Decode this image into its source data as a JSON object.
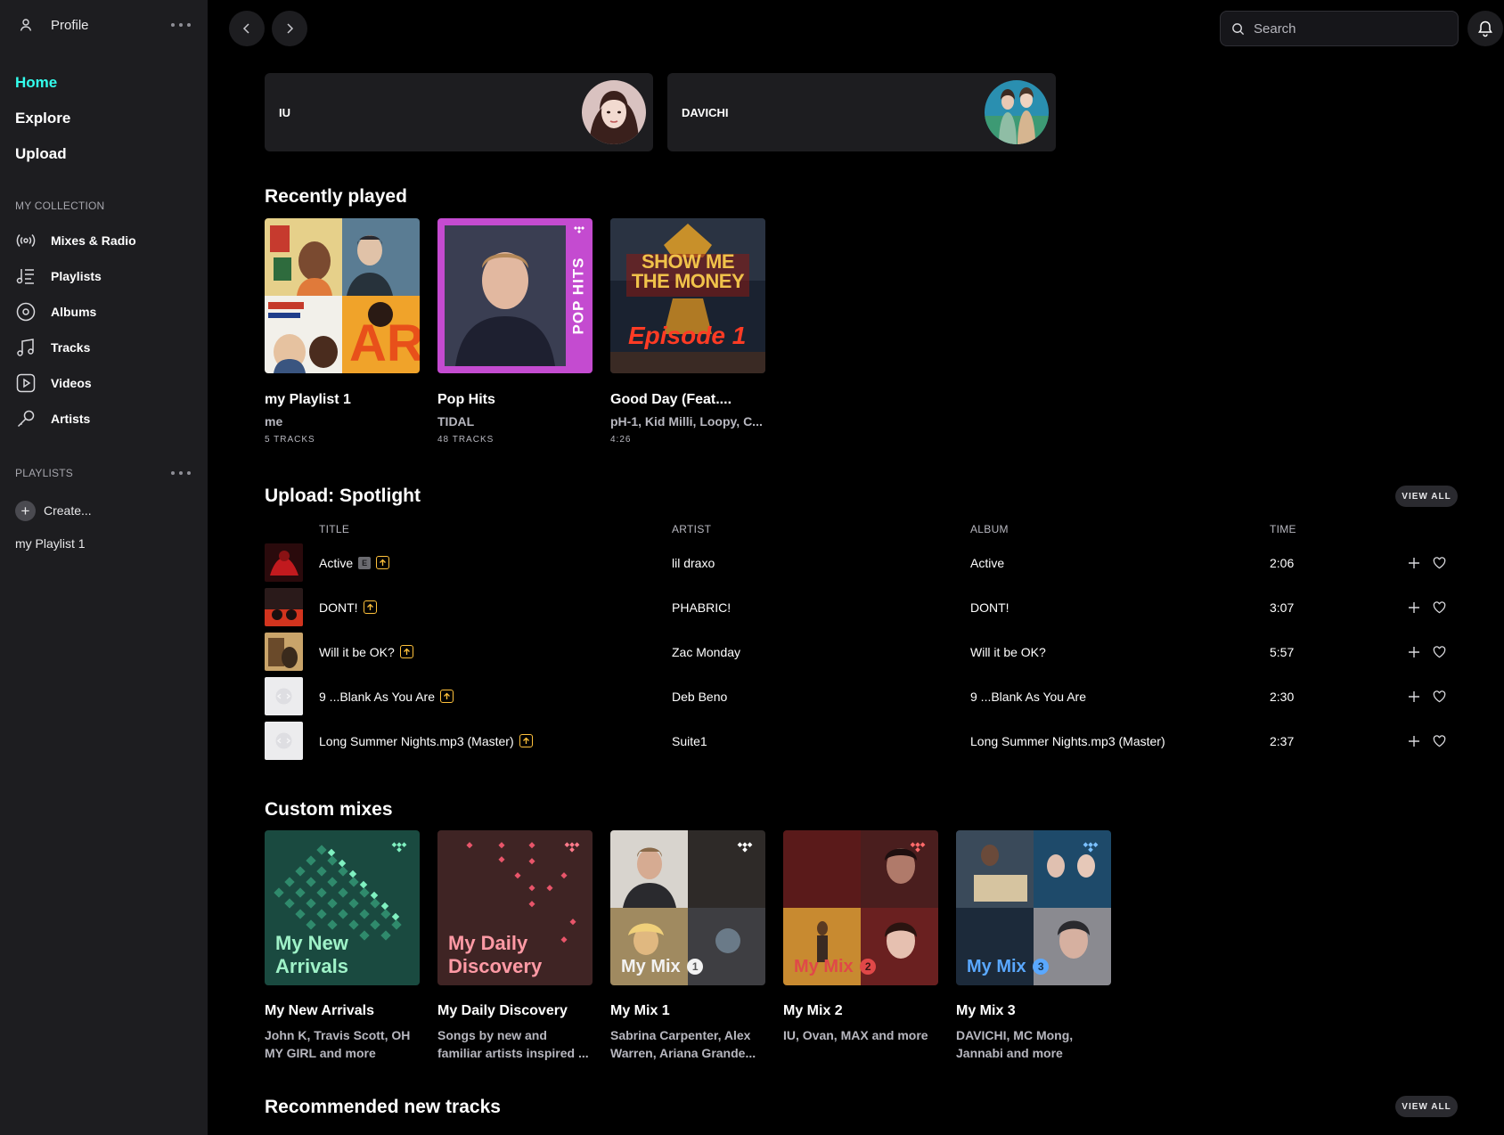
{
  "sidebar": {
    "profile_label": "Profile",
    "nav": [
      {
        "label": "Home",
        "active": true
      },
      {
        "label": "Explore",
        "active": false
      },
      {
        "label": "Upload",
        "active": false
      }
    ],
    "collection_heading": "MY COLLECTION",
    "collection": [
      {
        "label": "Mixes & Radio",
        "icon": "radio-icon"
      },
      {
        "label": "Playlists",
        "icon": "playlist-icon"
      },
      {
        "label": "Albums",
        "icon": "album-icon"
      },
      {
        "label": "Tracks",
        "icon": "music-note-icon"
      },
      {
        "label": "Videos",
        "icon": "video-icon"
      },
      {
        "label": "Artists",
        "icon": "microphone-icon"
      }
    ],
    "playlists_heading": "PLAYLISTS",
    "create_label": "Create...",
    "playlists": [
      "my Playlist 1"
    ]
  },
  "topbar": {
    "search_placeholder": "Search"
  },
  "artists": [
    {
      "name": "IU"
    },
    {
      "name": "DAVICHI"
    }
  ],
  "recently_played": {
    "heading": "Recently played",
    "items": [
      {
        "title": "my Playlist 1",
        "subtitle": "me",
        "meta": "5 TRACKS"
      },
      {
        "title": "Pop Hits",
        "subtitle": "TIDAL",
        "meta": "48 TRACKS",
        "cover_text": "POP HITS"
      },
      {
        "title": "Good Day (Feat....",
        "subtitle": "pH-1, Kid Milli, Loopy, C...",
        "meta": "4:26",
        "cover_text_top": "SHOW ME THE MONEY",
        "cover_text": "Episode 1"
      }
    ]
  },
  "spotlight": {
    "heading": "Upload: Spotlight",
    "view_all": "VIEW ALL",
    "columns": {
      "title": "TITLE",
      "artist": "ARTIST",
      "album": "ALBUM",
      "time": "TIME"
    },
    "explicit_badge": "E",
    "tracks": [
      {
        "title": "Active",
        "explicit": true,
        "artist": "lil draxo",
        "album": "Active",
        "time": "2:06"
      },
      {
        "title": "DONT!",
        "explicit": false,
        "artist": "PHABRIC!",
        "album": "DONT!",
        "time": "3:07"
      },
      {
        "title": "Will it be OK?",
        "explicit": false,
        "artist": "Zac Monday",
        "album": "Will it be OK?",
        "time": "5:57"
      },
      {
        "title": "9 ...Blank As You Are",
        "explicit": false,
        "artist": "Deb Beno",
        "album": "9 ...Blank As You Are",
        "time": "2:30"
      },
      {
        "title": "Long Summer Nights.mp3 (Master)",
        "explicit": false,
        "artist": "Suite1",
        "album": "Long Summer Nights.mp3 (Master)",
        "time": "2:37"
      }
    ]
  },
  "custom_mixes": {
    "heading": "Custom mixes",
    "items": [
      {
        "cover_line1": "My New",
        "cover_line2": "Arrivals",
        "title": "My New Arrivals",
        "subtitle": "John K, Travis Scott, OH MY GIRL and more"
      },
      {
        "cover_line1": "My Daily",
        "cover_line2": "Discovery",
        "title": "My Daily Discovery",
        "subtitle": "Songs by new and familiar artists inspired ..."
      },
      {
        "cover_label": "My Mix",
        "cover_num": "1",
        "title": "My Mix 1",
        "subtitle": "Sabrina Carpenter, Alex Warren, Ariana Grande..."
      },
      {
        "cover_label": "My Mix",
        "cover_num": "2",
        "title": "My Mix 2",
        "subtitle": "IU, Ovan, MAX and more"
      },
      {
        "cover_label": "My Mix",
        "cover_num": "3",
        "title": "My Mix 3",
        "subtitle": "DAVICHI, MC Mong, Jannabi and more"
      }
    ]
  },
  "recommended": {
    "heading": "Recommended new tracks",
    "view_all": "VIEW ALL"
  },
  "colors": {
    "accent": "#33ffee",
    "upload_badge": "#ffc13b",
    "sidebar_bg": "#1d1d20"
  }
}
